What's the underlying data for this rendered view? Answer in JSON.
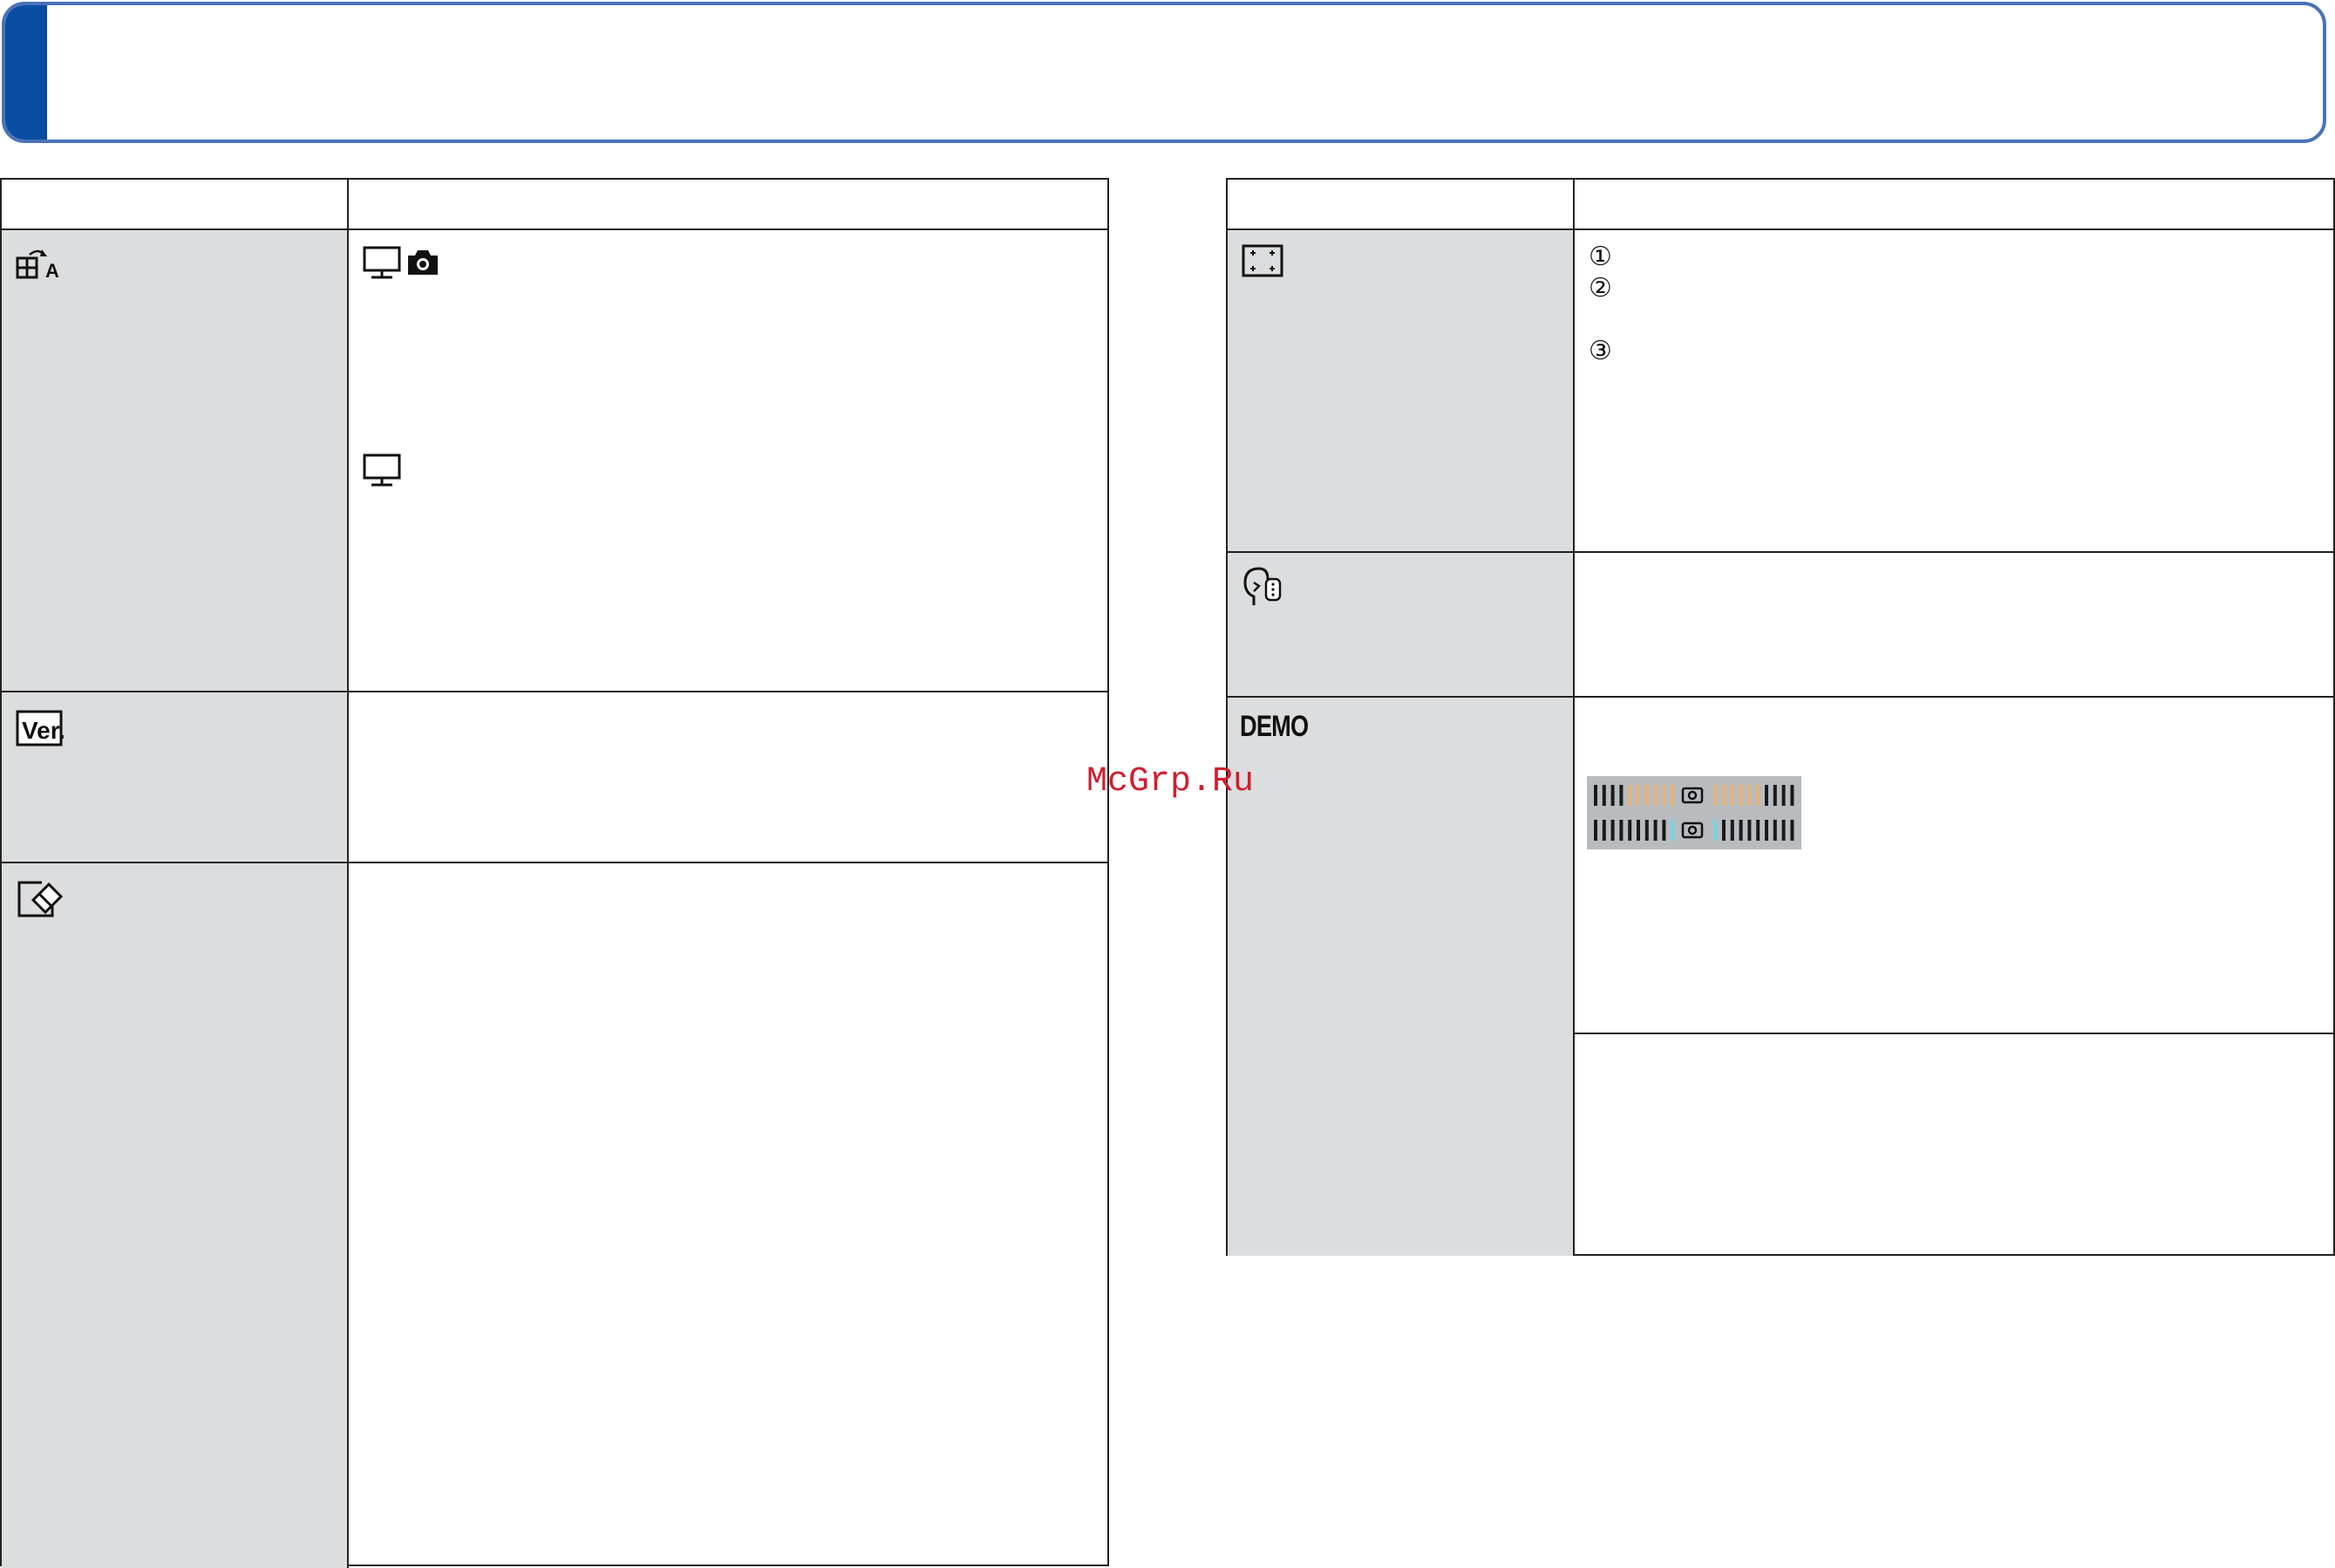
{
  "watermark": {
    "text": "McGrp.Ru"
  },
  "left_table": {
    "rows": [
      {
        "icon": "auto-rotate-icon"
      },
      {
        "icon": "version-display-icon",
        "icon_text": "Ver."
      },
      {
        "icon": "format-eraser-icon"
      }
    ],
    "row1_icons": [
      "monitor-camera-icon",
      "camera-icon",
      "monitor-icon"
    ]
  },
  "right_table": {
    "rows": [
      {
        "icon": "monitor-adjust-icon",
        "items": [
          "①",
          "②",
          "③"
        ]
      },
      {
        "icon": "face-sound-icon"
      },
      {
        "label": "DEMO"
      }
    ]
  },
  "colors": {
    "banner_border": "#4a73b8",
    "banner_accent": "#0a4ea3",
    "label_column": "#dcdddf",
    "watermark": "#d01f2e"
  }
}
